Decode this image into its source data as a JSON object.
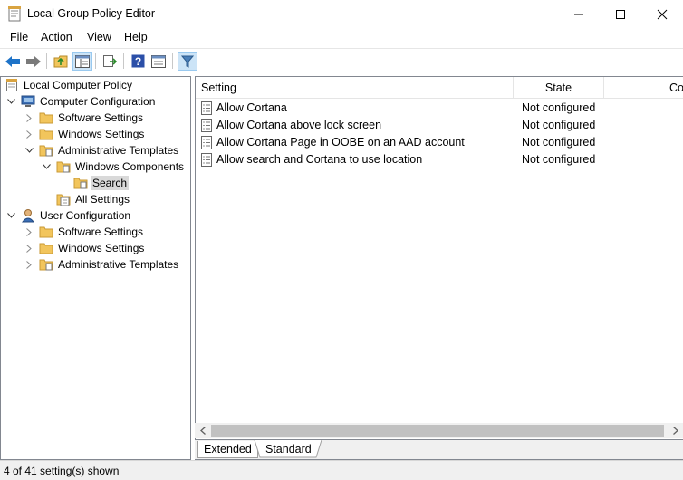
{
  "window": {
    "title": "Local Group Policy Editor"
  },
  "menu": [
    "File",
    "Action",
    "View",
    "Help"
  ],
  "toolbar": {
    "icons": [
      "back-arrow-icon",
      "forward-arrow-icon",
      "up-folder-icon",
      "show-hide-tree-icon",
      "export-list-icon",
      "help-icon",
      "properties-icon",
      "filter-icon"
    ]
  },
  "tree": {
    "root": "Local Computer Policy",
    "computer_config": "Computer Configuration",
    "cc_software": "Software Settings",
    "cc_windows": "Windows Settings",
    "cc_admin": "Administrative Templates",
    "windows_components": "Windows Components",
    "search": "Search",
    "all_settings": "All Settings",
    "user_config": "User Configuration",
    "uc_software": "Software Settings",
    "uc_windows": "Windows Settings",
    "uc_admin": "Administrative Templates"
  },
  "list": {
    "columns": [
      "Setting",
      "State",
      "Co"
    ],
    "rows": [
      {
        "setting": "Allow Cortana",
        "state": "Not configured"
      },
      {
        "setting": "Allow Cortana above lock screen",
        "state": "Not configured"
      },
      {
        "setting": "Allow Cortana Page in OOBE on an AAD account",
        "state": "Not configured"
      },
      {
        "setting": "Allow search and Cortana to use location",
        "state": "Not configured"
      }
    ]
  },
  "tabs": [
    "Extended",
    "Standard"
  ],
  "status": {
    "text": "4 of 41 setting(s) shown"
  },
  "colors": {
    "folder": "#f2c55c",
    "selection": "#d9d9d9",
    "accent": "#1e73c8"
  }
}
